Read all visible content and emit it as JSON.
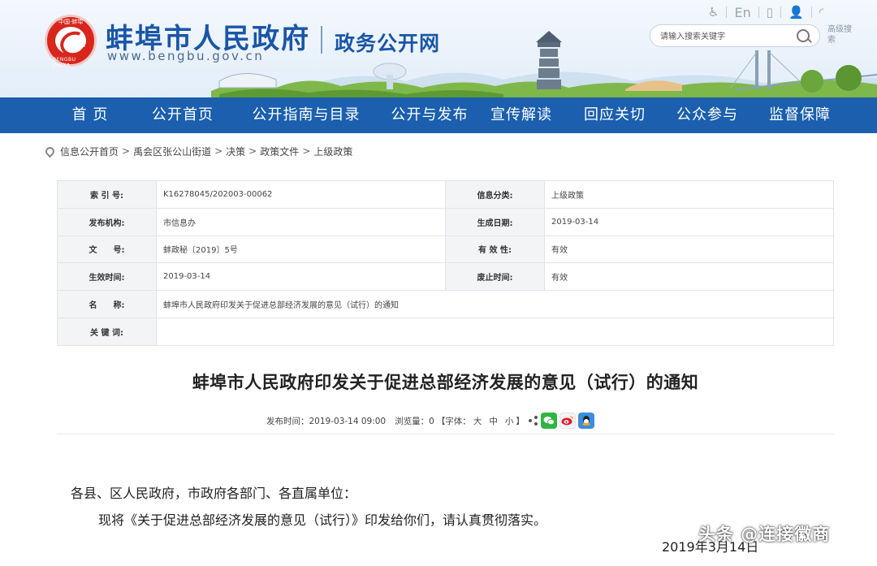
{
  "header": {
    "logo_top_text": "中国·蚌埠",
    "logo_bottom_text": "BENGBU CHINA",
    "site_title": "蚌埠市人民政府",
    "site_url": "www.bengbu.gov.cn",
    "subtitle": "政务公开网",
    "tools": [
      {
        "icon": "accessibility-icon",
        "glyph": "♿"
      },
      {
        "icon": "language-en-icon",
        "glyph": "En"
      },
      {
        "icon": "mobile-icon",
        "glyph": "▯"
      },
      {
        "icon": "user-icon",
        "glyph": "👤"
      },
      {
        "icon": "rss-icon",
        "glyph": "◜"
      }
    ],
    "search_placeholder": "请输入搜索关键字",
    "advanced_search": "高级搜索"
  },
  "nav": {
    "items": [
      "首 页",
      "公开首页",
      "公开指南与目录",
      "公开与发布",
      "宣传解读",
      "回应关切",
      "公众参与",
      "监督保障"
    ]
  },
  "breadcrumb": {
    "items": [
      "信息公开首页",
      "禹会区张公山街道",
      "决策",
      "政策文件",
      "上级政策"
    ],
    "separator": ">"
  },
  "info": {
    "index_label": "索 引 号:",
    "index_value": "K16278045/202003-00062",
    "category_label": "信息分类:",
    "category_value": "上级政策",
    "publisher_label": "发布机构:",
    "publisher_value": "市信息办",
    "generated_label": "生成日期:",
    "generated_value": "2019-03-14",
    "docno_label": "文　　号:",
    "docno_value": "蚌政秘〔2019〕5号",
    "validity_label": "有 效 性:",
    "validity_value": "有效",
    "effective_label": "生效时间:",
    "effective_value": "2019-03-14",
    "expiry_label": "废止时间:",
    "expiry_value": "有效",
    "name_label": "名　　称:",
    "name_value": "蚌埠市人民政府印发关于促进总部经济发展的意见（试行）的通知",
    "keywords_label": "关 键 词:",
    "keywords_value": ""
  },
  "article": {
    "title": "蚌埠市人民政府印发关于促进总部经济发展的意见（试行）的通知",
    "meta_publish": "发布时间：2019-03-14 09:00",
    "meta_views": "浏览量：0",
    "meta_font": "【字体：",
    "font_large": "大",
    "font_medium": "中",
    "font_small": "小",
    "meta_font_end": "】",
    "salutation": "各县、区人民政府，市政府各部门、各直属单位：",
    "paragraph": "现将《关于促进总部经济发展的意见（试行）》印发给你们，请认真贯彻落实。",
    "bottom_date": "2019年3月14日",
    "watermark": "头条 @连接徽商"
  },
  "colors": {
    "nav_bg": "#1b5fae",
    "title_blue": "#1a56a8",
    "logo_red": "#d8261d"
  }
}
